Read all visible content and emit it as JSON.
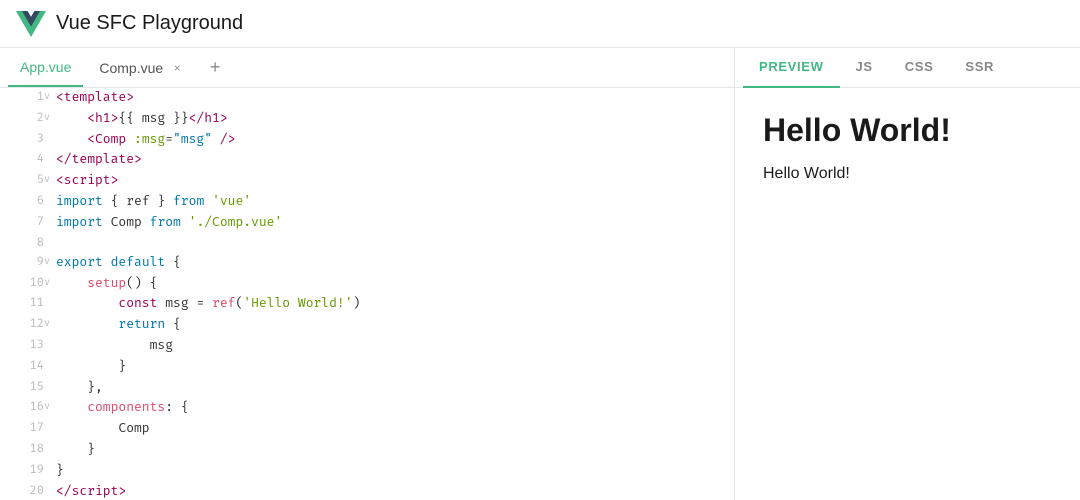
{
  "header": {
    "title": "Vue SFC Playground"
  },
  "tabs": [
    {
      "id": "app-vue",
      "label": "App.vue",
      "active": true,
      "closable": false
    },
    {
      "id": "comp-vue",
      "label": "Comp.vue",
      "active": false,
      "closable": true
    }
  ],
  "tab_add_label": "+",
  "code_lines": [
    {
      "num": "1",
      "fold": "v",
      "html": "<span class='c-tag'>&lt;template&gt;</span>"
    },
    {
      "num": "2",
      "fold": "v",
      "html": "    <span class='c-tag'>&lt;h1&gt;</span><span class='c-bracket'>{{ </span><span class='c-var'>msg</span><span class='c-bracket'> }}</span><span class='c-tag'>&lt;/h1&gt;</span>"
    },
    {
      "num": "3",
      "fold": "",
      "html": "    <span class='c-tag'>&lt;Comp </span><span class='c-attr-name'>:msg</span><span class='c-punctuation'>=</span><span class='c-attr-val'>\"msg\"</span><span class='c-tag'> /&gt;</span>"
    },
    {
      "num": "4",
      "fold": "",
      "html": "<span class='c-tag'>&lt;/template&gt;</span>"
    },
    {
      "num": "5",
      "fold": "v",
      "html": "<span class='c-tag'>&lt;script&gt;</span>"
    },
    {
      "num": "6",
      "fold": "",
      "html": "<span class='c-import-kw'>import</span> <span class='c-punctuation'>{ </span><span class='c-var'>ref</span><span class='c-punctuation'> } </span><span class='c-import-kw'>from</span> <span class='c-string'>'vue'</span>"
    },
    {
      "num": "7",
      "fold": "",
      "html": "<span class='c-import-kw'>import</span> <span class='c-var'>Comp</span> <span class='c-import-kw'>from</span> <span class='c-string'>'./Comp.vue'</span>"
    },
    {
      "num": "8",
      "fold": "",
      "html": ""
    },
    {
      "num": "9",
      "fold": "v",
      "html": "<span class='c-keyword'>export</span> <span class='c-keyword'>default</span> <span class='c-punctuation'>{</span>"
    },
    {
      "num": "10",
      "fold": "v",
      "html": "    <span class='c-fn'>setup</span><span class='c-punctuation'>() {</span>"
    },
    {
      "num": "11",
      "fold": "",
      "html": "        <span class='c-const-kw'>const</span> <span class='c-var'>msg</span> <span class='c-punctuation'>=</span> <span class='c-fn'>ref</span><span class='c-punctuation'>(</span><span class='c-string'>'Hello World!'</span><span class='c-punctuation'>)</span>"
    },
    {
      "num": "12",
      "fold": "v",
      "html": "        <span class='c-keyword'>return</span> <span class='c-punctuation'>{</span>"
    },
    {
      "num": "13",
      "fold": "",
      "html": "            <span class='c-var'>msg</span>"
    },
    {
      "num": "14",
      "fold": "",
      "html": "        <span class='c-punctuation'>}</span>"
    },
    {
      "num": "15",
      "fold": "",
      "html": "    <span class='c-punctuation'>},</span>"
    },
    {
      "num": "16",
      "fold": "v",
      "html": "    <span class='c-property'>components</span><span class='c-punctuation'>: {</span>"
    },
    {
      "num": "17",
      "fold": "",
      "html": "        <span class='c-var'>Comp</span>"
    },
    {
      "num": "18",
      "fold": "",
      "html": "    <span class='c-punctuation'>}</span>"
    },
    {
      "num": "19",
      "fold": "",
      "html": "<span class='c-punctuation'>}</span>"
    },
    {
      "num": "20",
      "fold": "",
      "html": "<span class='c-tag'>&lt;/script&gt;</span>"
    }
  ],
  "preview_tabs": [
    {
      "id": "preview",
      "label": "PREVIEW",
      "active": true
    },
    {
      "id": "js",
      "label": "JS",
      "active": false
    },
    {
      "id": "css",
      "label": "CSS",
      "active": false
    },
    {
      "id": "ssr",
      "label": "SSR",
      "active": false
    }
  ],
  "preview": {
    "heading": "Hello World!",
    "paragraph": "Hello World!"
  }
}
